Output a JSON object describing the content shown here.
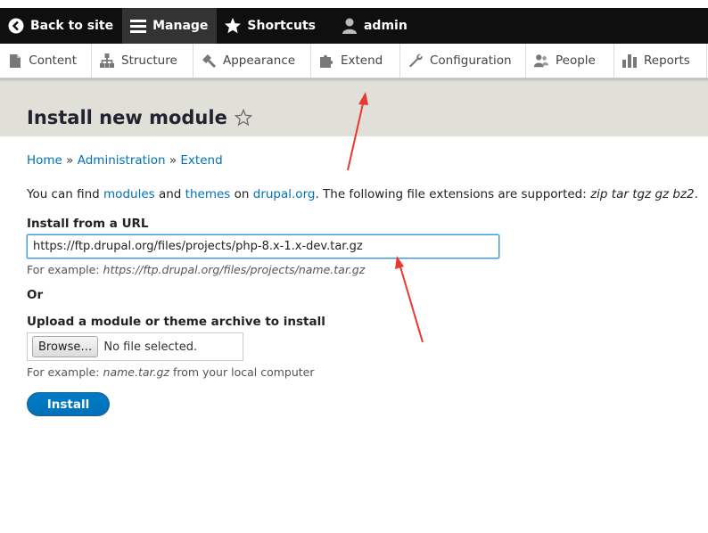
{
  "toolbar": {
    "items": [
      {
        "label": "Back to site",
        "icon": "back-arrow-icon"
      },
      {
        "label": "Manage",
        "icon": "hamburger-menu-icon",
        "active": true
      },
      {
        "label": "Shortcuts",
        "icon": "star-icon"
      },
      {
        "label": "admin",
        "icon": "user-icon"
      }
    ]
  },
  "tray": {
    "items": [
      {
        "label": "Content",
        "icon": "document-icon"
      },
      {
        "label": "Structure",
        "icon": "structure-icon"
      },
      {
        "label": "Appearance",
        "icon": "paint-icon"
      },
      {
        "label": "Extend",
        "icon": "puzzle-icon"
      },
      {
        "label": "Configuration",
        "icon": "wrench-icon"
      },
      {
        "label": "People",
        "icon": "people-icon"
      },
      {
        "label": "Reports",
        "icon": "bar-chart-icon"
      }
    ]
  },
  "page": {
    "title": "Install new module"
  },
  "breadcrumb": {
    "items": [
      "Home",
      "Administration",
      "Extend"
    ],
    "separator": "»"
  },
  "intro": {
    "prefix": "You can find",
    "modules_link": "modules",
    "and": "and",
    "themes_link": "themes",
    "on": "on",
    "drupal_link": "drupal.org",
    "suffix": ". The following file extensions are supported:",
    "extensions": "zip tar tgz gz bz2",
    "end": "."
  },
  "url_field": {
    "label": "Install from a URL",
    "value": "https://ftp.drupal.org/files/projects/php-8.x-1.x-dev.tar.gz",
    "desc_prefix": "For example:",
    "desc_example": "https://ftp.drupal.org/files/projects/name.tar.gz"
  },
  "or_label": "Or",
  "upload_field": {
    "label": "Upload a module or theme archive to install",
    "browse_label": "Browse…",
    "status": "No file selected.",
    "desc_prefix": "For example:",
    "desc_example": "name.tar.gz",
    "desc_suffix": "from your local computer"
  },
  "actions": {
    "install_label": "Install"
  },
  "colors": {
    "toolbar_bg": "#0f0f0f",
    "link": "#0071b8",
    "header_bg": "#e0e0d8",
    "button_primary": "#0071b8",
    "annotation_arrow": "#e8382f"
  }
}
